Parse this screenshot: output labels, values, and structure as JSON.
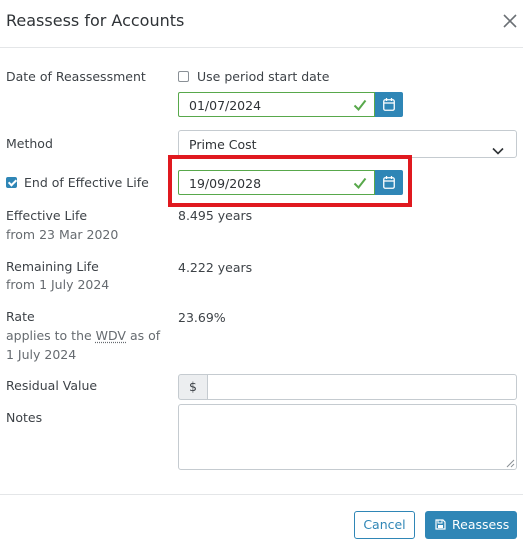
{
  "dialog": {
    "title": "Reassess for Accounts"
  },
  "date_of_reassessment": {
    "label": "Date of Reassessment",
    "use_period_label": "Use period start date",
    "value": "01/07/2024"
  },
  "method": {
    "label": "Method",
    "selected": "Prime Cost"
  },
  "end_of_effective_life": {
    "label": "End of Effective Life",
    "checked": true,
    "value": "19/09/2028"
  },
  "effective_life": {
    "label": "Effective Life",
    "sublabel": "from 23 Mar 2020",
    "value": "8.495 years"
  },
  "remaining_life": {
    "label": "Remaining Life",
    "sublabel": "from 1 July 2024",
    "value": "4.222 years"
  },
  "rate": {
    "label": "Rate",
    "sub_prefix": "applies to the ",
    "sub_abbr": "WDV",
    "sub_suffix": " as of",
    "sub_line2": "1 July 2024",
    "value": "23.69%"
  },
  "residual_value": {
    "label": "Residual Value",
    "currency": "$",
    "value": ""
  },
  "notes": {
    "label": "Notes",
    "value": ""
  },
  "footer": {
    "cancel_label": "Cancel",
    "reassess_label": "Reassess"
  },
  "colors": {
    "accent": "#2f86b6",
    "valid": "#58a84b",
    "highlight": "#e0191f"
  }
}
